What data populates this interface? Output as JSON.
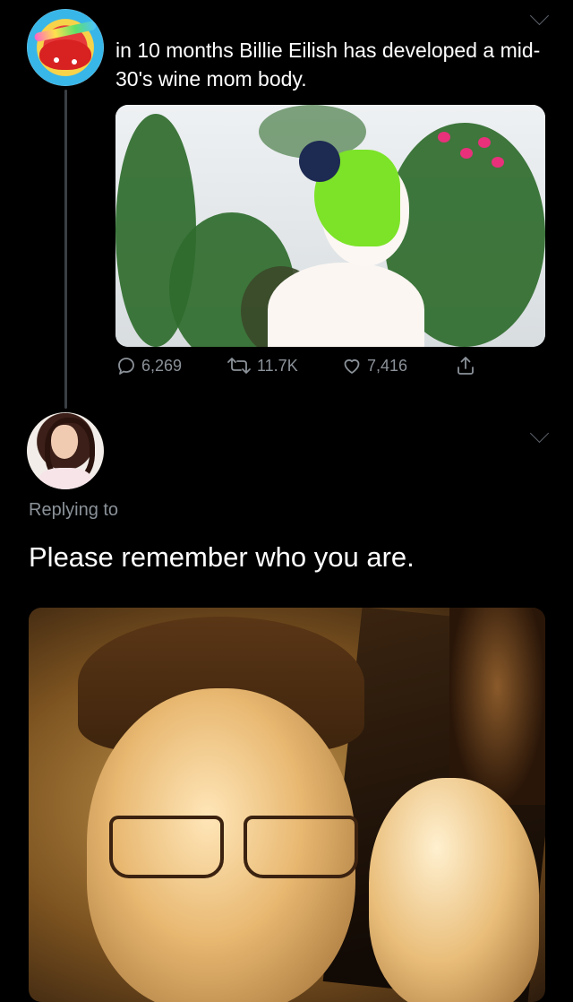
{
  "tweet": {
    "text": "in 10 months Billie Eilish has developed a mid-30's wine mom body.",
    "stats": {
      "replies": "6,269",
      "retweets": "11.7K",
      "likes": "7,416"
    }
  },
  "reply": {
    "replying_label": "Replying to",
    "text": "Please remember who you are."
  },
  "colors": {
    "background": "#000000",
    "secondary_text": "#8b9299",
    "thread_line": "#3a3f44"
  },
  "icons": {
    "reply": "reply-icon",
    "retweet": "retweet-icon",
    "like": "heart-icon",
    "share": "share-icon",
    "more": "chevron-down-icon"
  }
}
